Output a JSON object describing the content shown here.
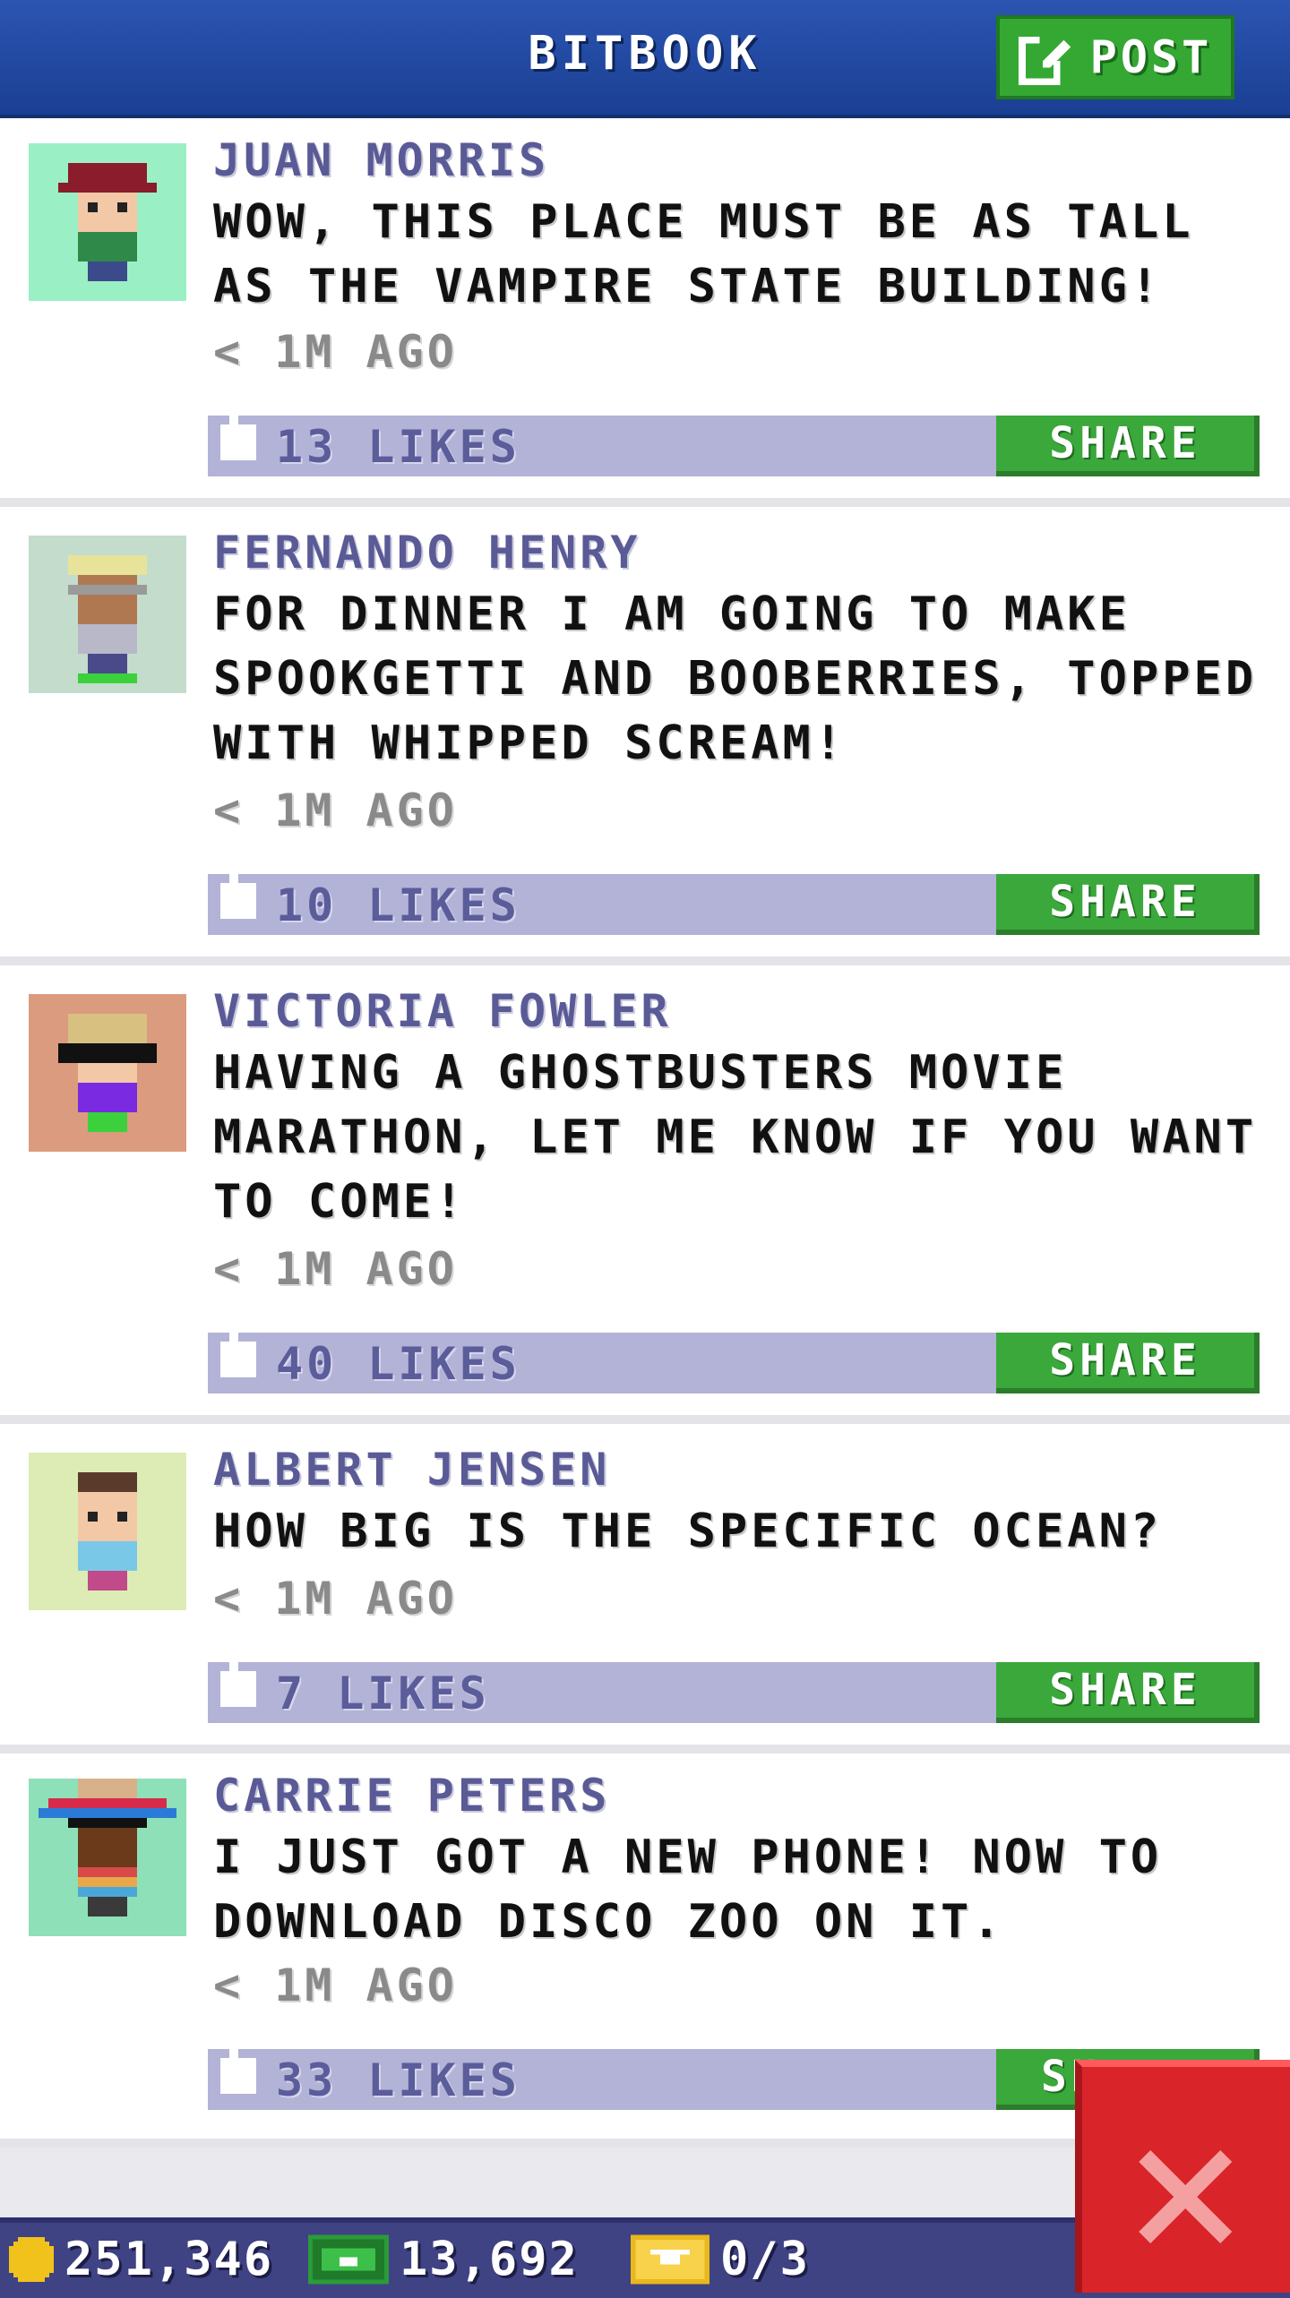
{
  "app": {
    "title": "BITBOOK",
    "post_label": "POST",
    "colors": {
      "header": "#2c55b2",
      "accent_green": "#35a834",
      "likes_bar": "#b2b3d6",
      "close_red": "#d9252a"
    }
  },
  "posts": [
    {
      "author": "JUAN MORRIS",
      "message": "WOW, THIS PLACE MUST BE AS TALL AS THE VAMPIRE STATE BUILDING!",
      "time": "< 1M AGO",
      "likes": "13 LIKES",
      "share_label": "SHARE",
      "avatar_bg": "#9af0c4",
      "avatar_icon": "avatar-juan-morris"
    },
    {
      "author": "FERNANDO HENRY",
      "message": "FOR DINNER I AM GOING TO MAKE SPOOKGETTI AND BOOBERRIES, TOPPED WITH WHIPPED SCREAM!",
      "time": "< 1M AGO",
      "likes": "10 LIKES",
      "share_label": "SHARE",
      "avatar_bg": "#c4dccc",
      "avatar_icon": "avatar-fernando-henry"
    },
    {
      "author": "VICTORIA FOWLER",
      "message": "HAVING A GHOSTBUSTERS MOVIE MARATHON, LET ME KNOW IF YOU WANT TO COME!",
      "time": "< 1M AGO",
      "likes": "40 LIKES",
      "share_label": "SHARE",
      "avatar_bg": "#db9b7e",
      "avatar_icon": "avatar-victoria-fowler"
    },
    {
      "author": "ALBERT JENSEN",
      "message": "HOW BIG IS THE SPECIFIC OCEAN?",
      "time": "< 1M AGO",
      "likes": "7 LIKES",
      "share_label": "SHARE",
      "avatar_bg": "#dcecb4",
      "avatar_icon": "avatar-albert-jensen"
    },
    {
      "author": "CARRIE PETERS",
      "message": "I JUST GOT A NEW PHONE! NOW TO DOWNLOAD DISCO ZOO ON IT.",
      "time": "< 1M AGO",
      "likes": "33 LIKES",
      "share_label": "SH",
      "avatar_bg": "#8ee0b8",
      "avatar_icon": "avatar-carrie-peters"
    }
  ],
  "footer": {
    "coins": "251,346",
    "bux": "13,692",
    "tickets": "0/3"
  }
}
